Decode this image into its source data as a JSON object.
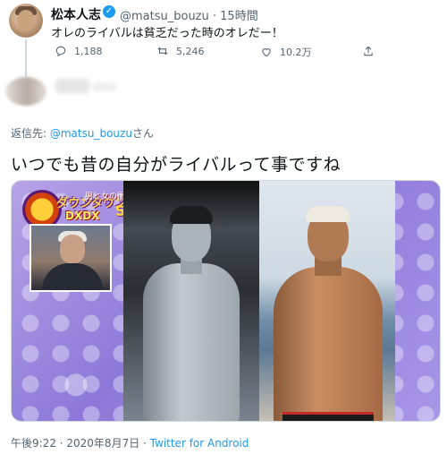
{
  "parent_tweet": {
    "author_name": "松本人志",
    "handle": "@matsu_bouzu",
    "time": "15時間",
    "text": "オレのライバルは貧乏だった時のオレだー！",
    "replies": "1,188",
    "retweets": "5,246",
    "likes": "10.2万"
  },
  "reply": {
    "reply_to_prefix": "返信先: ",
    "reply_to_handle": "@matsu_bouzu",
    "reply_to_suffix": "さん",
    "text": "いつでも昔の自分がライバルって事ですね",
    "timestamp": "午後9:22 · 2020年8月7日 · ",
    "source": "Twitter for Android"
  },
  "media": {
    "logo_line1": "ダウンタウン",
    "logo_line2": "DXDX",
    "logo_line3": "SP",
    "logo_side": "男と女の衝撃告白"
  },
  "colors": {
    "accent": "#1d9bf0",
    "secondary_text": "#536471",
    "media_bg": "#8d78d9"
  },
  "icons": {
    "reply": "reply-icon",
    "retweet": "retweet-icon",
    "like": "heart-icon",
    "share": "share-icon",
    "verified": "verified-badge-icon"
  }
}
